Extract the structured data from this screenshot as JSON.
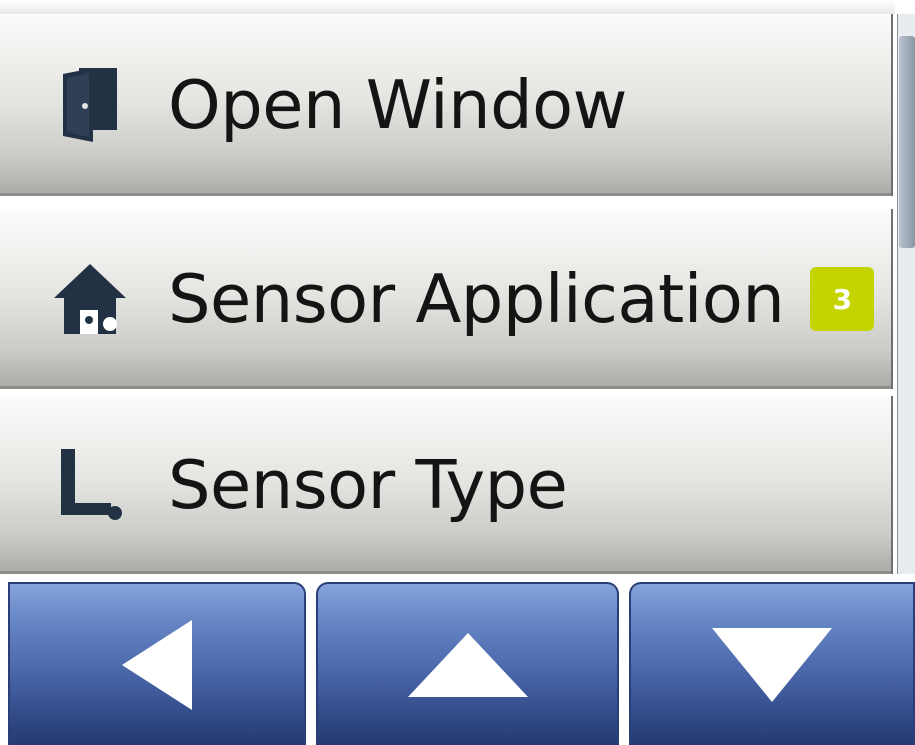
{
  "menu": {
    "items": [
      {
        "label": "Open Window",
        "icon": "door-icon"
      },
      {
        "label": "Sensor Application",
        "icon": "house-icon",
        "badge": "3"
      },
      {
        "label": "Sensor Type",
        "icon": "floor-sensor-icon"
      }
    ]
  },
  "colors": {
    "badge": "#c3d400",
    "icon": "#233144",
    "nav_button": "#4966a9"
  },
  "nav": {
    "buttons": [
      {
        "icon": "left-arrow-icon"
      },
      {
        "icon": "up-arrow-icon"
      },
      {
        "icon": "down-arrow-icon"
      }
    ]
  }
}
